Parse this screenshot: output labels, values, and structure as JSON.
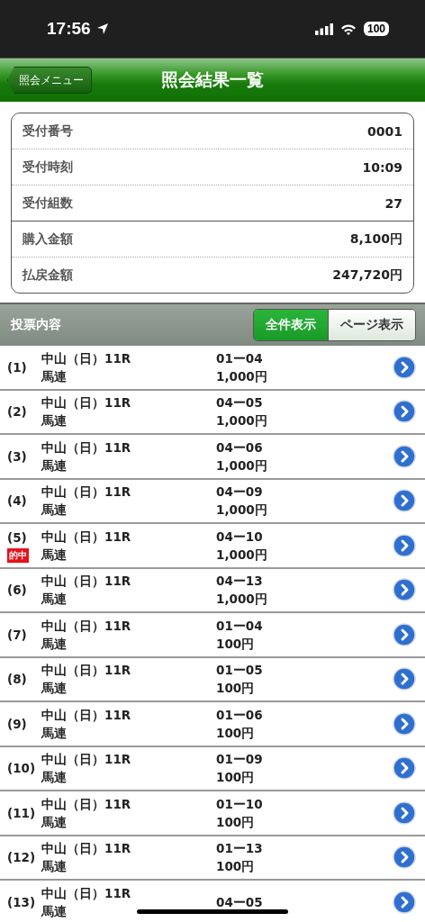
{
  "status_bar": {
    "time": "17:56",
    "battery": "100"
  },
  "nav": {
    "back": "照会メニュー",
    "title": "照会結果一覧"
  },
  "summary": [
    {
      "rows": [
        {
          "label": "受付番号",
          "value": "0001"
        },
        {
          "label": "受付時刻",
          "value": "10:09"
        },
        {
          "label": "受付組数",
          "value": "27"
        }
      ]
    },
    {
      "rows": [
        {
          "label": "購入金額",
          "value": "8,100円"
        },
        {
          "label": "払戻金額",
          "value": "247,720円"
        }
      ]
    }
  ],
  "section": {
    "title": "投票内容",
    "tabs": [
      {
        "label": "全件表示",
        "selected": true
      },
      {
        "label": "ページ表示",
        "selected": false
      }
    ]
  },
  "bets": [
    {
      "no": "(1)",
      "race": "中山（日）11R",
      "type": "馬連",
      "combo": "01ー04",
      "amount": "1,000円"
    },
    {
      "no": "(2)",
      "race": "中山（日）11R",
      "type": "馬連",
      "combo": "04ー05",
      "amount": "1,000円"
    },
    {
      "no": "(3)",
      "race": "中山（日）11R",
      "type": "馬連",
      "combo": "04ー06",
      "amount": "1,000円"
    },
    {
      "no": "(4)",
      "race": "中山（日）11R",
      "type": "馬連",
      "combo": "04ー09",
      "amount": "1,000円"
    },
    {
      "no": "(5)",
      "badge": "的中",
      "race": "中山（日）11R",
      "type": "馬連",
      "combo": "04ー10",
      "amount": "1,000円"
    },
    {
      "no": "(6)",
      "race": "中山（日）11R",
      "type": "馬連",
      "combo": "04ー13",
      "amount": "1,000円"
    },
    {
      "no": "(7)",
      "race": "中山（日）11R",
      "type": "馬連",
      "combo": "01ー04",
      "amount": "100円"
    },
    {
      "no": "(8)",
      "race": "中山（日）11R",
      "type": "馬連",
      "combo": "01ー05",
      "amount": "100円"
    },
    {
      "no": "(9)",
      "race": "中山（日）11R",
      "type": "馬連",
      "combo": "01ー06",
      "amount": "100円"
    },
    {
      "no": "(10)",
      "race": "中山（日）11R",
      "type": "馬連",
      "combo": "01ー09",
      "amount": "100円"
    },
    {
      "no": "(11)",
      "race": "中山（日）11R",
      "type": "馬連",
      "combo": "01ー10",
      "amount": "100円"
    },
    {
      "no": "(12)",
      "race": "中山（日）11R",
      "type": "馬連",
      "combo": "01ー13",
      "amount": "100円"
    },
    {
      "no": "(13)",
      "race": "中山（日）11R",
      "type": "馬連",
      "combo": "04ー05"
    }
  ]
}
